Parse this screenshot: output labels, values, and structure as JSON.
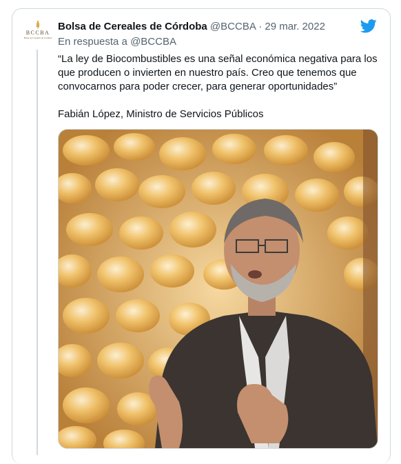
{
  "tweet": {
    "avatar": {
      "brand": "BCCBA",
      "tagline": "Bolsa de Cereales de Córdoba"
    },
    "author_name": "Bolsa de Cereales de Córdoba",
    "author_handle": "@BCCBA",
    "separator": "·",
    "date": "29 mar. 2022",
    "reply_prefix": "En respuesta a",
    "reply_handle": "@BCCBA",
    "quote_line": "“La ley de Biocombustibles es una señal económica negativa para los que producen o invierten en nuestro país. Creo que tenemos que convocarnos para poder crecer, para generar oportunidades”",
    "attribution": "Fabián López, Ministro de Servicios Públicos",
    "image_alt_icon": "photo-of-speaker-with-corn-background"
  },
  "colors": {
    "twitter_blue": "#1d9bf0",
    "text_primary": "#0f1419",
    "text_secondary": "#536471",
    "border": "#cfd9de"
  },
  "icons": {
    "brand_icon": "twitter-bird-icon",
    "logo_icon": "wheat-icon"
  }
}
